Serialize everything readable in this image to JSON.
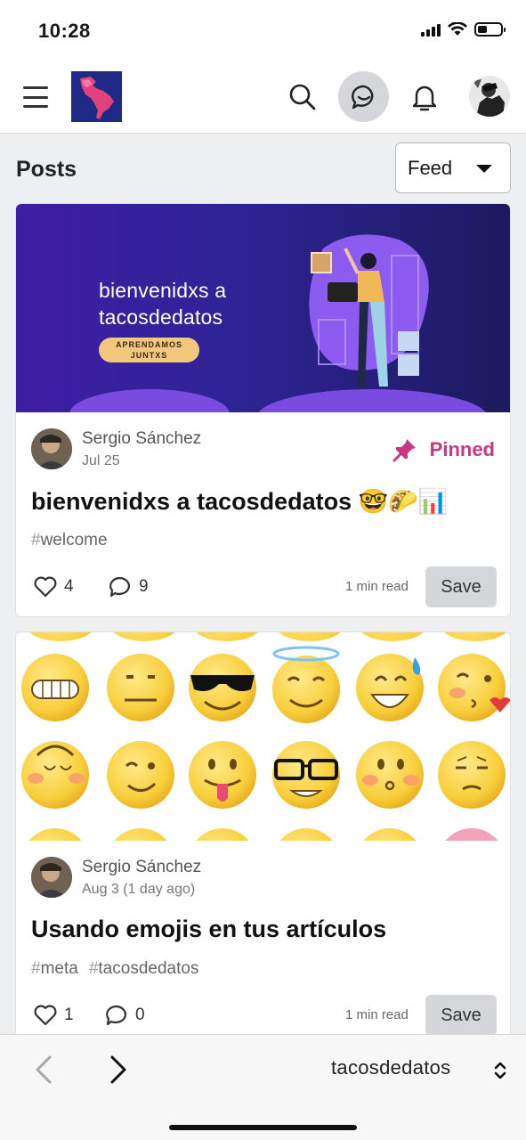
{
  "status": {
    "time": "10:28"
  },
  "header": {
    "menu_icon": "hamburger-icon",
    "logo_icon": "latin-america-map-logo",
    "search_icon": "search-icon",
    "chat_icon": "chat-bubble-icon",
    "bell_icon": "bell-icon"
  },
  "posts": {
    "title": "Posts",
    "feed_select": "Feed"
  },
  "cards": [
    {
      "cover_title_line1": "bienvenidxs a",
      "cover_title_line2": "tacosdedatos",
      "cover_pill_line1": "APRENDAMOS",
      "cover_pill_line2": "JUNTXS",
      "author": "Sergio Sánchez",
      "date": "Jul 25",
      "pinned_label": "Pinned",
      "title": "bienvenidxs a tacosdedatos 🤓🌮📊",
      "tags": [
        "welcome"
      ],
      "reactions": "4",
      "comments": "9",
      "read_time": "1 min read",
      "save_label": "Save"
    },
    {
      "author": "Sergio Sánchez",
      "date": "Aug 3 (1 day ago)",
      "title": "Usando emojis en tus artículos",
      "tags": [
        "meta",
        "tacosdedatos"
      ],
      "reactions": "1",
      "comments": "0",
      "read_time": "1 min read",
      "save_label": "Save"
    }
  ],
  "bottom_bar": {
    "site": "tacosdedatos"
  },
  "colors": {
    "pinned": "#c8377f",
    "cover_purple": "#3f1ea6",
    "accent_pill": "#f2c77e"
  }
}
